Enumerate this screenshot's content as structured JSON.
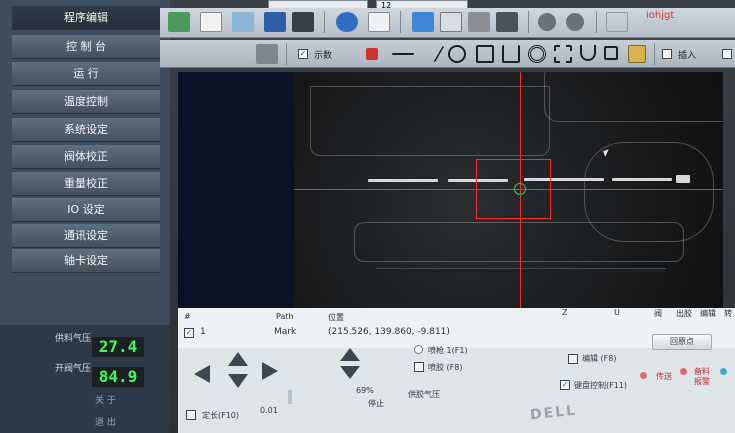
{
  "sidebar": {
    "items": [
      {
        "label": "程序编辑"
      },
      {
        "label": "控 制 台"
      },
      {
        "label": "运    行"
      },
      {
        "label": "温度控制"
      },
      {
        "label": "系统设定"
      },
      {
        "label": "阀体校正"
      },
      {
        "label": "重量校正"
      },
      {
        "label": "IO 设定"
      },
      {
        "label": "通讯设定"
      },
      {
        "label": "轴卡设定"
      }
    ],
    "pressure": {
      "supply_label": "供料气压",
      "supply_value": "27.4",
      "open_label": "开阀气压",
      "open_value": "84.9",
      "footer_1": "关    于",
      "footer_2": "退    出"
    }
  },
  "toolbar": {
    "user_label": "iohjgt",
    "combo_value": "12",
    "show_numbers_label": "示数",
    "insert_label": "插入"
  },
  "table": {
    "headers": [
      "#",
      "Path",
      "位置",
      "Z",
      "U",
      "阀",
      "出胶",
      "编辑",
      "转"
    ],
    "rows": [
      {
        "index": "1",
        "path": "Mark",
        "position": "(215.526, 139.860, -9.811)"
      }
    ]
  },
  "controls": {
    "nozzle_label": "喷枪 1(F1)",
    "nozzle2_label": "喷胶 (F8)",
    "edit_label": "编辑 (F8)",
    "keyboard_label": "键盘控制(F11)",
    "origin_label": "回原点",
    "speed_label": "69%",
    "pause_label": "停止",
    "fixed_length_label": "定长(F10)",
    "step_value": "0.01",
    "supply_pressure_label": "供胶气压",
    "status_labels": [
      "传送",
      "备料",
      "报警"
    ]
  },
  "colors": {
    "accent_red": "#e53935",
    "digit_green": "#39ff5a",
    "crosshair": "#ff2a2a",
    "target_green": "#2fd34a"
  }
}
